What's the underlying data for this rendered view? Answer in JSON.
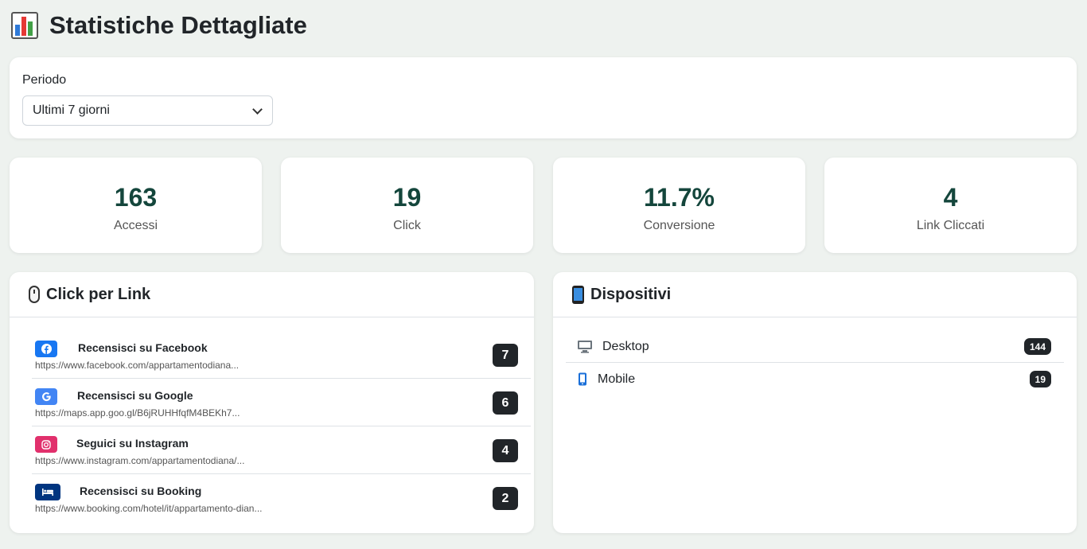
{
  "header": {
    "title": "Statistiche Dettagliate",
    "icon": "bar-chart-icon"
  },
  "filter": {
    "label": "Periodo",
    "selected": "Ultimi 7 giorni"
  },
  "stats": [
    {
      "value": "163",
      "label": "Accessi"
    },
    {
      "value": "19",
      "label": "Click"
    },
    {
      "value": "11.7%",
      "label": "Conversione"
    },
    {
      "value": "4",
      "label": "Link Cliccati"
    }
  ],
  "links_panel": {
    "title": "Click per Link",
    "icon": "mouse-icon",
    "items": [
      {
        "name": "Recensisci su Facebook",
        "url": "https://www.facebook.com/appartamentodiana...",
        "count": "7",
        "icon": "facebook-icon",
        "color": "#1877f2"
      },
      {
        "name": "Recensisci su Google",
        "url": "https://maps.app.goo.gl/B6jRUHHfqfM4BEKh7...",
        "count": "6",
        "icon": "google-icon",
        "color": "#4285f4"
      },
      {
        "name": "Seguici su Instagram",
        "url": "https://www.instagram.com/appartamentodiana/...",
        "count": "4",
        "icon": "instagram-icon",
        "color": "#e1306c"
      },
      {
        "name": "Recensisci su Booking",
        "url": "https://www.booking.com/hotel/it/appartamento-dian...",
        "count": "2",
        "icon": "bed-icon",
        "color": "#003580"
      }
    ]
  },
  "devices_panel": {
    "title": "Dispositivi",
    "icon": "mobile-phone-icon",
    "items": [
      {
        "label": "Desktop",
        "count": "144",
        "icon": "desktop-icon"
      },
      {
        "label": "Mobile",
        "count": "19",
        "icon": "mobile-icon"
      }
    ]
  },
  "colors": {
    "accent": "#14463c",
    "background": "#eef2ef",
    "badge": "#212529"
  }
}
